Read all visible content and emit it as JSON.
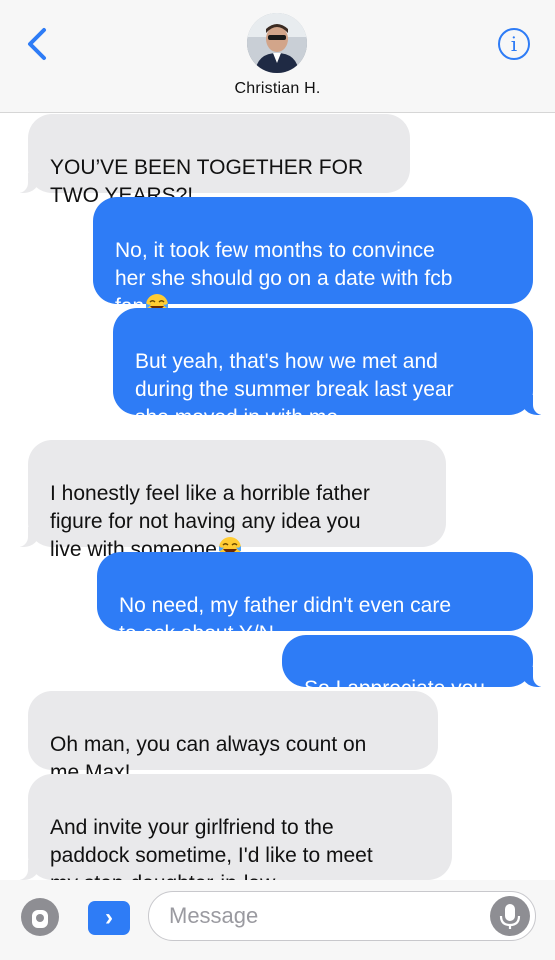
{
  "header": {
    "back_icon": "chevron-left-icon",
    "contact_name": "Christian H.",
    "info_icon_glyph": "i",
    "accent_color": "#2e7cf6"
  },
  "messages": [
    {
      "direction": "incoming",
      "text": "YOU’VE BEEN TOGETHER FOR\nTWO YEARS?!"
    },
    {
      "direction": "outgoing",
      "text": "No, it took few months to convince\nher she should go on a date with fcb\nfan",
      "emoji": "face-with-tears-of-joy"
    },
    {
      "direction": "outgoing",
      "text": "But yeah, that's how we met and\nduring the summer break last year\nshe moved in with me"
    },
    {
      "direction": "incoming",
      "text": "I honestly feel like a horrible father\nfigure for not having any idea you\nlive with someone",
      "emoji": "face-with-tears-of-joy"
    },
    {
      "direction": "outgoing",
      "text": "No need, my father didn't even care\nto ask about Y/N"
    },
    {
      "direction": "outgoing",
      "text": "So I appreciate you"
    },
    {
      "direction": "incoming",
      "text": "Oh man, you can always count on\nme Max!"
    },
    {
      "direction": "incoming",
      "text": "And invite your girlfriend to the\npaddock sometime, I'd like to meet\nmy step-daughter-in-law"
    }
  ],
  "input_bar": {
    "placeholder": "Message",
    "camera_icon": "camera-icon",
    "apps_icon": "app-store-icon",
    "apps_glyph": "›",
    "mic_icon": "microphone-icon"
  }
}
